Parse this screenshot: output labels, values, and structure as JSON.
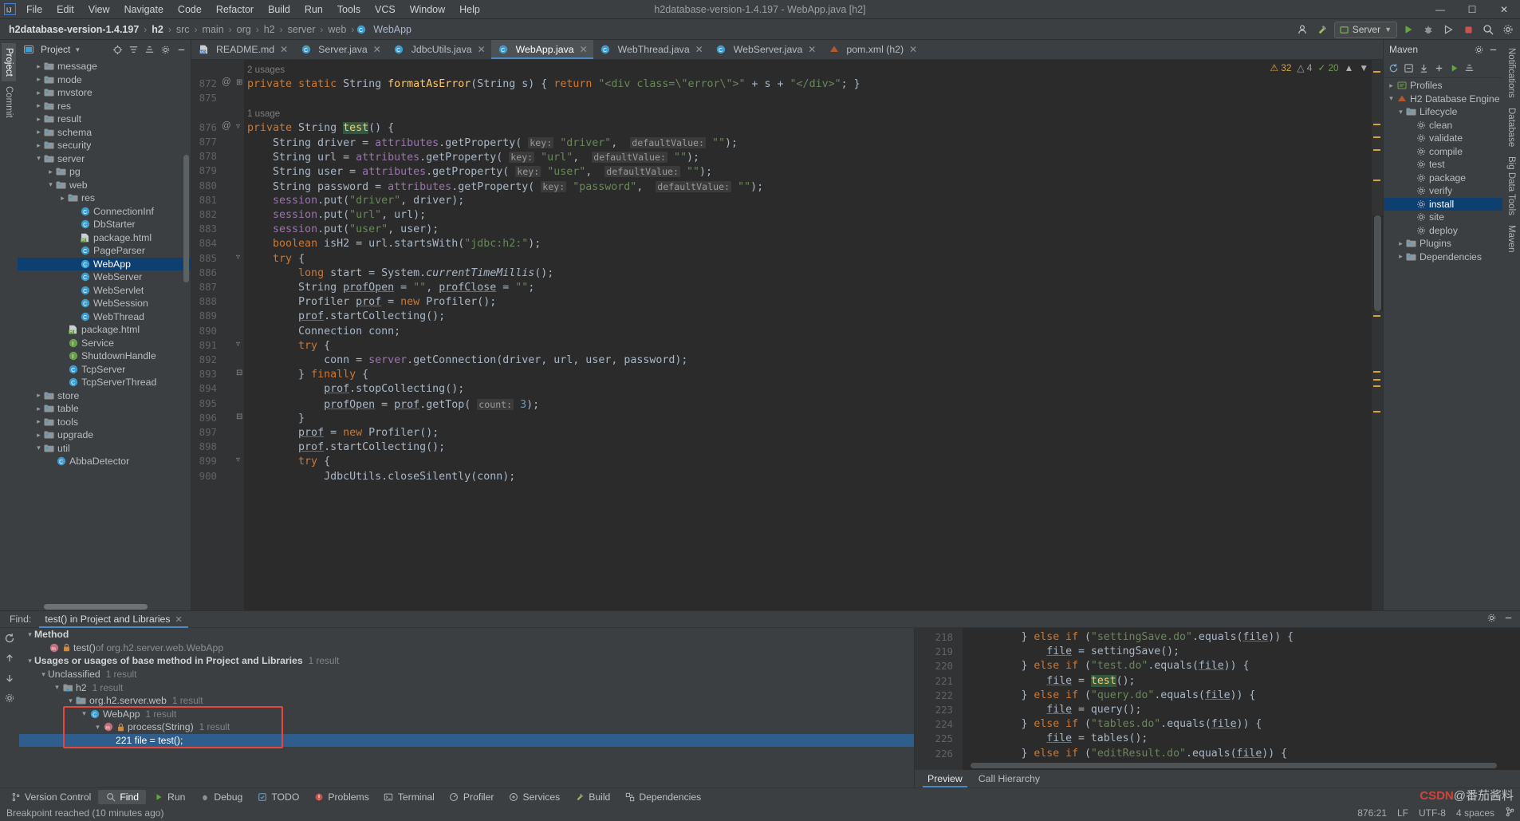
{
  "window": {
    "title": "h2database-version-1.4.197 - WebApp.java [h2]",
    "minimize": "—",
    "maximize": "☐",
    "close": "✕"
  },
  "menu": [
    "File",
    "Edit",
    "View",
    "Navigate",
    "Code",
    "Refactor",
    "Build",
    "Run",
    "Tools",
    "VCS",
    "Window",
    "Help"
  ],
  "breadcrumbs": [
    {
      "label": "h2database-version-1.4.197",
      "style": "strong"
    },
    {
      "label": "h2",
      "style": "strong"
    },
    {
      "label": "src",
      "style": "dim"
    },
    {
      "label": "main",
      "style": "dim"
    },
    {
      "label": "org",
      "style": "dim"
    },
    {
      "label": "h2",
      "style": "dim"
    },
    {
      "label": "server",
      "style": "dim"
    },
    {
      "label": "web",
      "style": "dim"
    },
    {
      "label": "WebApp",
      "style": "class"
    }
  ],
  "toolbar": {
    "run_config": "Server",
    "search_icon": "search-icon",
    "settings_icon": "gear-icon",
    "run_icon": "run-icon",
    "debug_icon": "debug-icon",
    "stop_icon": "stop-icon"
  },
  "left_rail": [
    {
      "label": "Project",
      "active": true
    },
    {
      "label": "Commit",
      "active": false
    }
  ],
  "right_rail": [
    {
      "label": "Notifications"
    },
    {
      "label": "Database"
    },
    {
      "label": "Big Data Tools"
    },
    {
      "label": "Maven"
    }
  ],
  "project": {
    "title": "Project",
    "tree": [
      {
        "label": "message",
        "type": "folder",
        "indent": 2,
        "arrow": "right"
      },
      {
        "label": "mode",
        "type": "folder",
        "indent": 2,
        "arrow": "right"
      },
      {
        "label": "mvstore",
        "type": "folder",
        "indent": 2,
        "arrow": "right"
      },
      {
        "label": "res",
        "type": "folder",
        "indent": 2,
        "arrow": "right"
      },
      {
        "label": "result",
        "type": "folder",
        "indent": 2,
        "arrow": "right"
      },
      {
        "label": "schema",
        "type": "folder",
        "indent": 2,
        "arrow": "right"
      },
      {
        "label": "security",
        "type": "folder",
        "indent": 2,
        "arrow": "right"
      },
      {
        "label": "server",
        "type": "folder",
        "indent": 2,
        "arrow": "down"
      },
      {
        "label": "pg",
        "type": "folder",
        "indent": 3,
        "arrow": "right"
      },
      {
        "label": "web",
        "type": "folder",
        "indent": 3,
        "arrow": "down"
      },
      {
        "label": "res",
        "type": "folder",
        "indent": 4,
        "arrow": "right"
      },
      {
        "label": "ConnectionInf",
        "type": "class",
        "indent": 5,
        "arrow": ""
      },
      {
        "label": "DbStarter",
        "type": "class",
        "indent": 5,
        "arrow": ""
      },
      {
        "label": "package.html",
        "type": "html",
        "indent": 5,
        "arrow": ""
      },
      {
        "label": "PageParser",
        "type": "class",
        "indent": 5,
        "arrow": ""
      },
      {
        "label": "WebApp",
        "type": "class",
        "indent": 5,
        "arrow": "",
        "selected": true
      },
      {
        "label": "WebServer",
        "type": "class",
        "indent": 5,
        "arrow": ""
      },
      {
        "label": "WebServlet",
        "type": "class",
        "indent": 5,
        "arrow": ""
      },
      {
        "label": "WebSession",
        "type": "class",
        "indent": 5,
        "arrow": ""
      },
      {
        "label": "WebThread",
        "type": "class",
        "indent": 5,
        "arrow": ""
      },
      {
        "label": "package.html",
        "type": "html",
        "indent": 4,
        "arrow": ""
      },
      {
        "label": "Service",
        "type": "interface",
        "indent": 4,
        "arrow": ""
      },
      {
        "label": "ShutdownHandle",
        "type": "interface",
        "indent": 4,
        "arrow": ""
      },
      {
        "label": "TcpServer",
        "type": "class",
        "indent": 4,
        "arrow": ""
      },
      {
        "label": "TcpServerThread",
        "type": "class",
        "indent": 4,
        "arrow": ""
      },
      {
        "label": "store",
        "type": "folder",
        "indent": 2,
        "arrow": "right"
      },
      {
        "label": "table",
        "type": "folder",
        "indent": 2,
        "arrow": "right"
      },
      {
        "label": "tools",
        "type": "folder",
        "indent": 2,
        "arrow": "right"
      },
      {
        "label": "upgrade",
        "type": "folder",
        "indent": 2,
        "arrow": "right"
      },
      {
        "label": "util",
        "type": "folder",
        "indent": 2,
        "arrow": "down"
      },
      {
        "label": "AbbaDetector",
        "type": "class",
        "indent": 3,
        "arrow": ""
      }
    ]
  },
  "editor": {
    "tabs": [
      {
        "label": "README.md",
        "icon": "md-icon",
        "active": false
      },
      {
        "label": "Server.java",
        "icon": "class-run-icon",
        "active": false
      },
      {
        "label": "JdbcUtils.java",
        "icon": "class-icon",
        "active": false
      },
      {
        "label": "WebApp.java",
        "icon": "class-icon",
        "active": true
      },
      {
        "label": "WebThread.java",
        "icon": "class-icon",
        "active": false
      },
      {
        "label": "WebServer.java",
        "icon": "class-icon",
        "active": false
      },
      {
        "label": "pom.xml (h2)",
        "icon": "maven-icon",
        "active": false
      }
    ],
    "inspection": {
      "warnings": "32",
      "weak_warnings": "4",
      "hints": "20"
    },
    "lines": [
      {
        "num": "",
        "text": "2 usages",
        "kind": "usage"
      },
      {
        "num": "872",
        "marker": "@",
        "fold": "+",
        "text": "private static String formatAsError(String s) { return \"<div class=\\\"error\\\">\" + s + \"</div>\"; }"
      },
      {
        "num": "875",
        "text": ""
      },
      {
        "num": "",
        "text": "1 usage",
        "kind": "usage"
      },
      {
        "num": "876",
        "marker": "@",
        "fold": "-",
        "text": "private String test() {"
      },
      {
        "num": "877",
        "text": "    String driver = attributes.getProperty( key: \"driver\", defaultValue: \"\");"
      },
      {
        "num": "878",
        "text": "    String url = attributes.getProperty( key: \"url\", defaultValue: \"\");"
      },
      {
        "num": "879",
        "text": "    String user = attributes.getProperty( key: \"user\", defaultValue: \"\");"
      },
      {
        "num": "880",
        "text": "    String password = attributes.getProperty( key: \"password\", defaultValue: \"\");"
      },
      {
        "num": "881",
        "text": "    session.put(\"driver\", driver);"
      },
      {
        "num": "882",
        "text": "    session.put(\"url\", url);"
      },
      {
        "num": "883",
        "text": "    session.put(\"user\", user);"
      },
      {
        "num": "884",
        "text": "    boolean isH2 = url.startsWith(\"jdbc:h2:\");"
      },
      {
        "num": "885",
        "fold": "-",
        "text": "    try {"
      },
      {
        "num": "886",
        "text": "        long start = System.currentTimeMillis();"
      },
      {
        "num": "887",
        "text": "        String profOpen = \"\", profClose = \"\";"
      },
      {
        "num": "888",
        "text": "        Profiler prof = new Profiler();"
      },
      {
        "num": "889",
        "text": "        prof.startCollecting();"
      },
      {
        "num": "890",
        "text": "        Connection conn;"
      },
      {
        "num": "891",
        "fold": "-",
        "text": "        try {"
      },
      {
        "num": "892",
        "text": "            conn = server.getConnection(driver, url, user, password);"
      },
      {
        "num": "893",
        "fold": "=",
        "text": "        } finally {"
      },
      {
        "num": "894",
        "text": "            prof.stopCollecting();"
      },
      {
        "num": "895",
        "text": "            profOpen = prof.getTop( count: 3);"
      },
      {
        "num": "896",
        "fold": "=",
        "text": "        }"
      },
      {
        "num": "897",
        "text": "        prof = new Profiler();"
      },
      {
        "num": "898",
        "text": "        prof.startCollecting();"
      },
      {
        "num": "899",
        "fold": "-",
        "text": "        try {"
      },
      {
        "num": "900",
        "text": "            JdbcUtils.closeSilently(conn);"
      }
    ]
  },
  "maven": {
    "title": "Maven",
    "tree": [
      {
        "label": "Profiles",
        "indent": 1,
        "arrow": "right",
        "icon": "profiles-icon"
      },
      {
        "label": "H2 Database Engine",
        "indent": 1,
        "arrow": "down",
        "icon": "maven-icon"
      },
      {
        "label": "Lifecycle",
        "indent": 2,
        "arrow": "down",
        "icon": "folder-icon"
      },
      {
        "label": "clean",
        "indent": 3,
        "arrow": "",
        "icon": "phase-icon"
      },
      {
        "label": "validate",
        "indent": 3,
        "arrow": "",
        "icon": "phase-icon"
      },
      {
        "label": "compile",
        "indent": 3,
        "arrow": "",
        "icon": "phase-icon"
      },
      {
        "label": "test",
        "indent": 3,
        "arrow": "",
        "icon": "phase-icon"
      },
      {
        "label": "package",
        "indent": 3,
        "arrow": "",
        "icon": "phase-icon"
      },
      {
        "label": "verify",
        "indent": 3,
        "arrow": "",
        "icon": "phase-icon"
      },
      {
        "label": "install",
        "indent": 3,
        "arrow": "",
        "icon": "phase-icon",
        "selected": true
      },
      {
        "label": "site",
        "indent": 3,
        "arrow": "",
        "icon": "phase-icon"
      },
      {
        "label": "deploy",
        "indent": 3,
        "arrow": "",
        "icon": "phase-icon"
      },
      {
        "label": "Plugins",
        "indent": 2,
        "arrow": "right",
        "icon": "folder-icon"
      },
      {
        "label": "Dependencies",
        "indent": 2,
        "arrow": "right",
        "icon": "folder-icon"
      }
    ]
  },
  "find": {
    "label": "Find:",
    "tab": "test() in Project and Libraries",
    "close": "✕",
    "results": [
      {
        "indent": 1,
        "arrow": "down",
        "label": "Method",
        "bold": true,
        "count": ""
      },
      {
        "indent": 2,
        "arrow": "",
        "icon": "method-icon",
        "lock": "lock-icon",
        "label": "test()",
        "suffix": " of org.h2.server.web.WebApp",
        "count": ""
      },
      {
        "indent": 1,
        "arrow": "down",
        "label": "Usages or usages of base method in Project and Libraries",
        "bold": true,
        "count": "1 result"
      },
      {
        "indent": 2,
        "arrow": "down",
        "label": "Unclassified",
        "count": "1 result"
      },
      {
        "indent": 3,
        "arrow": "down",
        "icon": "module-icon",
        "label": "h2",
        "count": "1 result"
      },
      {
        "indent": 4,
        "arrow": "down",
        "icon": "package-icon",
        "label": "org.h2.server.web",
        "count": "1 result"
      },
      {
        "indent": 5,
        "arrow": "down",
        "icon": "class-icon",
        "label": "WebApp",
        "count": "1 result",
        "boxed": true
      },
      {
        "indent": 6,
        "arrow": "down",
        "icon": "method-icon",
        "lock": "lock-icon",
        "label": "process(String)",
        "count": "1 result",
        "boxed": true
      },
      {
        "indent": 7,
        "arrow": "",
        "label": "221 file = test();",
        "count": "",
        "selected": true,
        "boxed": true
      }
    ],
    "preview": {
      "tabs": [
        {
          "label": "Preview",
          "active": true
        },
        {
          "label": "Call Hierarchy",
          "active": false
        }
      ],
      "lines": [
        {
          "num": "218",
          "text": "        } else if (\"settingSave.do\".equals(file)) {"
        },
        {
          "num": "219",
          "text": "            file = settingSave();"
        },
        {
          "num": "220",
          "text": "        } else if (\"test.do\".equals(file)) {"
        },
        {
          "num": "221",
          "text": "            file = test();"
        },
        {
          "num": "222",
          "text": "        } else if (\"query.do\".equals(file)) {"
        },
        {
          "num": "223",
          "text": "            file = query();"
        },
        {
          "num": "224",
          "text": "        } else if (\"tables.do\".equals(file)) {"
        },
        {
          "num": "225",
          "text": "            file = tables();"
        },
        {
          "num": "226",
          "text": "        } else if (\"editResult.do\".equals(file)) {"
        }
      ]
    }
  },
  "bottom_tools": [
    {
      "label": "Version Control",
      "icon": "vcs-icon",
      "active": false
    },
    {
      "label": "Find",
      "icon": "search-icon",
      "active": true
    },
    {
      "label": "Run",
      "icon": "run-icon",
      "active": false
    },
    {
      "label": "Debug",
      "icon": "debug-icon",
      "active": false
    },
    {
      "label": "TODO",
      "icon": "todo-icon",
      "active": false
    },
    {
      "label": "Problems",
      "icon": "problems-icon",
      "active": false
    },
    {
      "label": "Terminal",
      "icon": "terminal-icon",
      "active": false
    },
    {
      "label": "Profiler",
      "icon": "profiler-icon",
      "active": false
    },
    {
      "label": "Services",
      "icon": "services-icon",
      "active": false
    },
    {
      "label": "Build",
      "icon": "build-icon",
      "active": false
    },
    {
      "label": "Dependencies",
      "icon": "dependencies-icon",
      "active": false
    }
  ],
  "statusbar": {
    "message": "Breakpoint reached (10 minutes ago)",
    "caret": "876:21",
    "line_sep": "LF",
    "encoding": "UTF-8",
    "indent": "4 spaces",
    "branch": "git-branch-icon"
  },
  "watermark": {
    "prefix": "CSDN",
    "suffix": "@番茄酱料"
  }
}
